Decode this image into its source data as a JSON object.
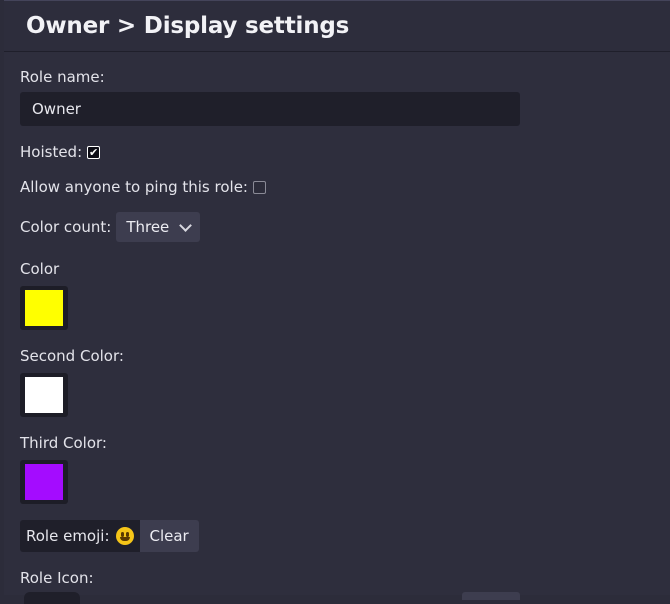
{
  "header": {
    "title": "Owner > Display settings"
  },
  "form": {
    "role_name_label": "Role name:",
    "role_name_value": "Owner",
    "hoisted_label": "Hoisted:",
    "hoisted_checked": true,
    "mentionable_label": "Allow anyone to ping this role:",
    "mentionable_checked": false,
    "color_count_label": "Color count:",
    "color_count_value": "Three",
    "color_label": "Color",
    "color_value": "#ffff00",
    "second_color_label": "Second Color:",
    "second_color_value": "#ffffff",
    "third_color_label": "Third Color:",
    "third_color_value": "#a40cff",
    "role_emoji_label": "Role emoji:",
    "role_emoji_icon": "grinning-face-icon",
    "clear_label": "Clear",
    "role_icon_label": "Role Icon:"
  },
  "colors": {
    "background": "#2c2c3a",
    "input_bg": "#1f1f2a",
    "button_bg": "#3d3d4f"
  }
}
